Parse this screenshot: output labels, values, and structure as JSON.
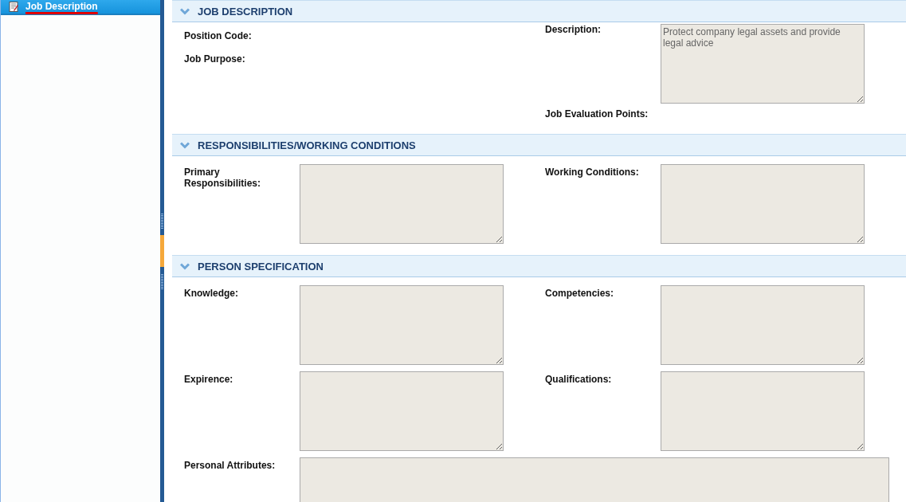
{
  "sidebar": {
    "items": [
      {
        "label": "Job Description",
        "selected": true
      }
    ]
  },
  "sections": [
    {
      "title": "JOB DESCRIPTION",
      "expanded": true,
      "kind": "columns",
      "left": [
        {
          "label": "Position Code:",
          "kind": "label"
        },
        {
          "label": "Job Purpose:",
          "kind": "label"
        }
      ],
      "right": [
        {
          "label": "Description:",
          "kind": "textarea",
          "value": "Protect company legal assets and provide legal advice"
        },
        {
          "label": "Job Evaluation Points:",
          "kind": "label"
        }
      ]
    },
    {
      "title": "RESPONSIBILITIES/WORKING CONDITIONS",
      "expanded": true,
      "kind": "rows",
      "rows": [
        [
          {
            "label": "Primary Responsibilities:",
            "kind": "textarea"
          },
          {
            "label": "Working Conditions:",
            "kind": "textarea"
          }
        ]
      ]
    },
    {
      "title": "PERSON SPECIFICATION",
      "expanded": true,
      "kind": "rows",
      "rows": [
        [
          {
            "label": "Knowledge:",
            "kind": "textarea"
          },
          {
            "label": "Competencies:",
            "kind": "textarea"
          }
        ],
        [
          {
            "label": "Expirence:",
            "kind": "textarea"
          },
          {
            "label": "Qualifications:",
            "kind": "textarea"
          }
        ],
        [
          {
            "label": "Personal Attributes:",
            "kind": "wide"
          }
        ]
      ]
    }
  ]
}
